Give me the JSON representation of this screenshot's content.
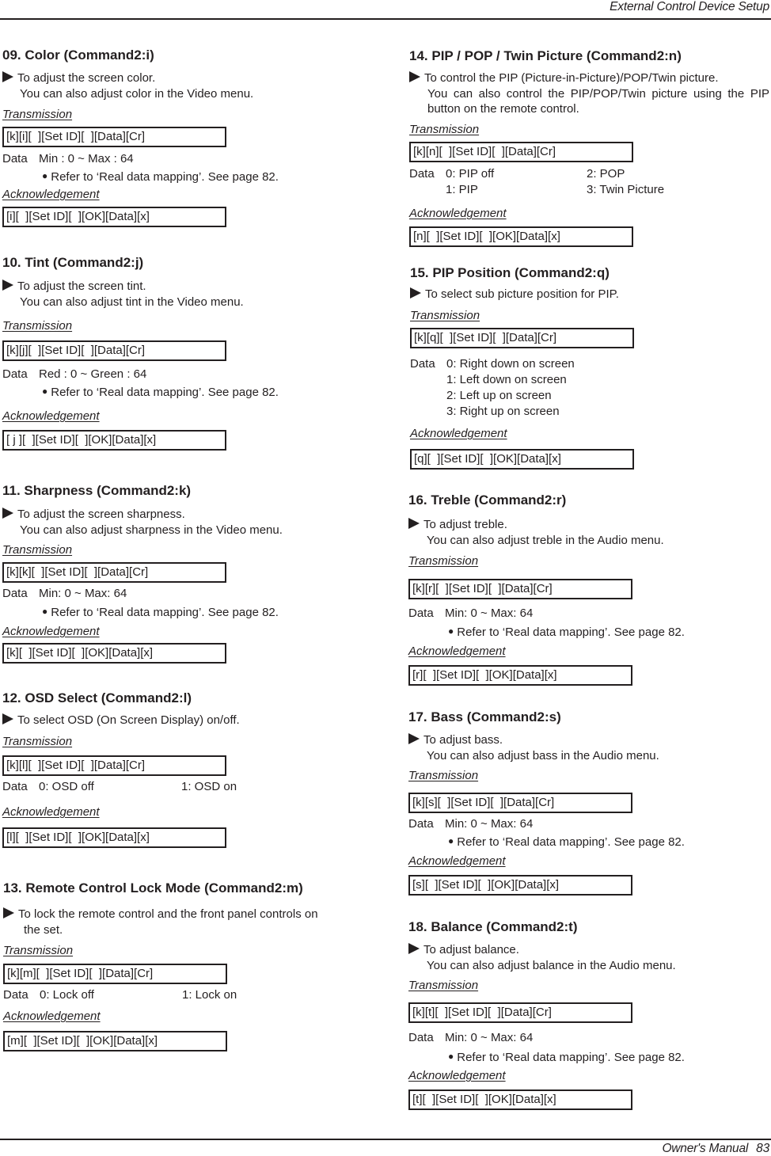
{
  "header": {
    "title": "External Control Device Setup"
  },
  "footer": {
    "manual": "Owner's Manual",
    "page": "83"
  },
  "common": {
    "transmission_label": "Transmission",
    "acknowledgement_label": "Acknowledgement",
    "data_label": "Data",
    "note": "Refer to ‘Real data mapping’. See page 82."
  },
  "sections": {
    "color": {
      "title": "09. Color (Command2:i)",
      "desc1": "To adjust the screen color.",
      "desc2": "You can also adjust color in the Video menu.",
      "transmission": "[k][i][  ][Set ID][  ][Data][Cr]",
      "data": "Min : 0 ~ Max : 64",
      "acknowledgement": "[i][  ][Set ID][  ][OK][Data][x]"
    },
    "tint": {
      "title": "10. Tint (Command2:j)",
      "desc1": "To adjust the screen tint.",
      "desc2": "You can also adjust tint in the Video menu.",
      "transmission": "[k][j][  ][Set ID][  ][Data][Cr]",
      "data": "Red : 0 ~ Green : 64",
      "acknowledgement": "[ j ][  ][Set ID][  ][OK][Data][x]"
    },
    "sharpness": {
      "title": "11. Sharpness (Command2:k)",
      "desc1": "To adjust the screen sharpness.",
      "desc2": "You can also adjust sharpness in the Video menu.",
      "transmission": "[k][k][  ][Set ID][  ][Data][Cr]",
      "data": "Min: 0 ~ Max: 64",
      "acknowledgement": "[k][  ][Set ID][  ][OK][Data][x]"
    },
    "osd": {
      "title": "12. OSD Select (Command2:l)",
      "desc1": "To select OSD (On Screen Display) on/off.",
      "transmission": "[k][l][  ][Set ID][  ][Data][Cr]",
      "options": [
        "0: OSD off",
        "1: OSD on"
      ],
      "acknowledgement": "[l][  ][Set ID][  ][OK][Data][x]"
    },
    "lock": {
      "title": "13. Remote Control Lock Mode (Command2:m)",
      "desc1": "To lock the remote control and the front panel controls on",
      "desc2": "the set.",
      "transmission": "[k][m][  ][Set ID][  ][Data][Cr]",
      "options": [
        "0: Lock off",
        "1: Lock on"
      ],
      "acknowledgement": "[m][  ][Set ID][  ][OK][Data][x]"
    },
    "pip": {
      "title": "14. PIP / POP / Twin Picture (Command2:n)",
      "desc1": "To control the PIP (Picture-in-Picture)/POP/Twin picture.",
      "desc2": "You can also control the PIP/POP/Twin picture using the PIP button on the remote control.",
      "transmission": "[k][n][  ][Set ID][  ][Data][Cr]",
      "options": [
        "0: PIP off",
        "1: PIP",
        "2: POP",
        "3: Twin Picture"
      ],
      "acknowledgement": "[n][  ][Set ID][  ][OK][Data][x]"
    },
    "pip_position": {
      "title": "15. PIP Position (Command2:q)",
      "desc1": "To select sub picture position for PIP.",
      "transmission": "[k][q][  ][Set ID][  ][Data][Cr]",
      "options": [
        "0: Right down on screen",
        "1: Left down on screen",
        "2: Left up on screen",
        "3: Right up on screen"
      ],
      "acknowledgement": "[q][  ][Set ID][  ][OK][Data][x]"
    },
    "treble": {
      "title": "16. Treble (Command2:r)",
      "desc1": "To adjust treble.",
      "desc2": "You can also adjust treble in the Audio menu.",
      "transmission": "[k][r][  ][Set ID][  ][Data][Cr]",
      "data": "Min: 0 ~ Max: 64",
      "acknowledgement": "[r][  ][Set ID][  ][OK][Data][x]"
    },
    "bass": {
      "title": "17. Bass (Command2:s)",
      "desc1": "To adjust bass.",
      "desc2": "You can also adjust bass in the Audio menu.",
      "transmission": "[k][s][  ][Set ID][  ][Data][Cr]",
      "data": "Min: 0 ~ Max: 64",
      "acknowledgement": "[s][  ][Set ID][  ][OK][Data][x]"
    },
    "balance": {
      "title": "18. Balance (Command2:t)",
      "desc1": "To adjust balance.",
      "desc2": "You can also adjust balance in the Audio menu.",
      "transmission": "[k][t][  ][Set ID][  ][Data][Cr]",
      "data": "Min: 0 ~ Max: 64",
      "acknowledgement": "[t][  ][Set ID][  ][OK][Data][x]"
    }
  }
}
